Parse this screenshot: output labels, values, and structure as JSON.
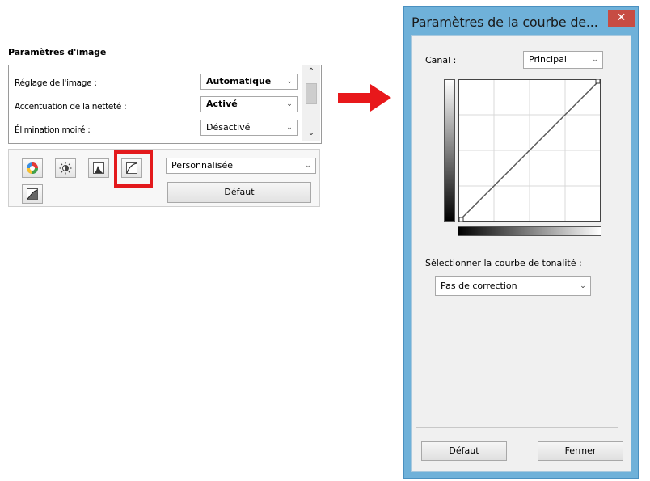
{
  "left_panel": {
    "title": "Paramètres d'image",
    "rows": [
      {
        "label": "Réglage de l'image :",
        "value": "Automatique"
      },
      {
        "label": "Accentuation de la netteté :",
        "value": "Activé"
      },
      {
        "label": "Élimination moiré :",
        "value": "Désactivé"
      }
    ],
    "preset_value": "Personnalisée",
    "default_label": "Défaut",
    "tools": [
      "color-balance-icon",
      "brightness-icon",
      "histogram-icon",
      "tone-curve-icon",
      "threshold-icon"
    ]
  },
  "dialog": {
    "title": "Paramètres de la courbe de...",
    "close_glyph": "✕",
    "channel_label": "Canal :",
    "channel_value": "Principal",
    "tone_label": "Sélectionner la courbe de tonalité :",
    "tone_value": "Pas de correction",
    "default_label": "Défaut",
    "close_label": "Fermer"
  },
  "colors": {
    "highlight": "#e3191c",
    "arrow": "#e8181b",
    "dialog_frame": "#6fb1d9",
    "close_button": "#c74c43"
  }
}
